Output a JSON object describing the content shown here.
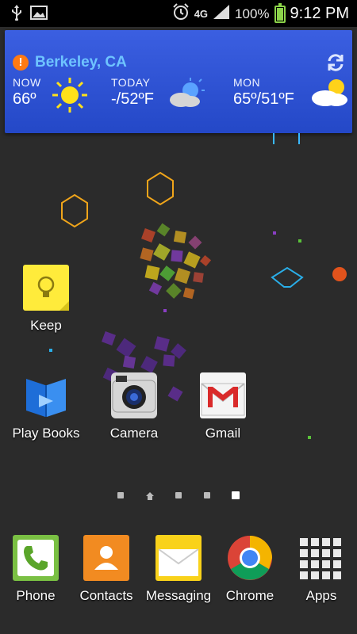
{
  "status_bar": {
    "network": "4G",
    "battery": "100%",
    "time": "9:12 PM"
  },
  "weather": {
    "city": "Berkeley, CA",
    "now_label": "NOW",
    "now_temp": "66º",
    "today_label": "TODAY",
    "today_temp": "-/52ºF",
    "mon_label": "MON",
    "mon_temp": "65º/51ºF"
  },
  "home_apps": [
    {
      "label": "Keep"
    },
    {
      "label": "Play Books"
    },
    {
      "label": "Camera"
    },
    {
      "label": "Gmail"
    }
  ],
  "dock": [
    {
      "label": "Phone"
    },
    {
      "label": "Contacts"
    },
    {
      "label": "Messaging"
    },
    {
      "label": "Chrome"
    },
    {
      "label": "Apps"
    }
  ],
  "colors": {
    "widget_bg": "#2e55d6",
    "city_text": "#6ec4ff",
    "alert": "#ff7a12",
    "battery": "#8bd34a"
  }
}
